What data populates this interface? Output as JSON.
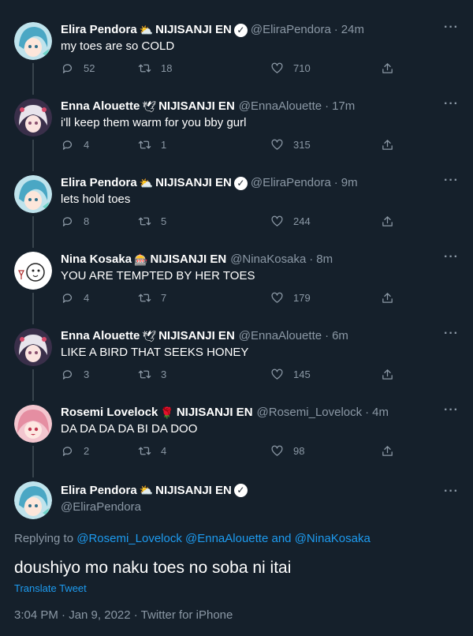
{
  "tweets": [
    {
      "name": "Elira Pendora",
      "emoji": "⛅",
      "org": "NIJISANJI EN",
      "verified": true,
      "handle": "@EliraPendora",
      "time": "24m",
      "text": "my toes are so COLD",
      "replies": "52",
      "retweets": "18",
      "likes": "710",
      "avatar": "elira-avatar"
    },
    {
      "name": "Enna Alouette",
      "emoji": "🕊",
      "org": "NIJISANJI EN",
      "verified": false,
      "handle": "@EnnaAlouette",
      "time": "17m",
      "text": "i'll keep them warm for you bby gurl",
      "replies": "4",
      "retweets": "1",
      "likes": "315",
      "avatar": "enna-avatar"
    },
    {
      "name": "Elira Pendora",
      "emoji": "⛅",
      "org": "NIJISANJI EN",
      "verified": true,
      "handle": "@EliraPendora",
      "time": "9m",
      "text": "lets hold toes",
      "replies": "8",
      "retweets": "5",
      "likes": "244",
      "avatar": "elira-avatar"
    },
    {
      "name": "Nina Kosaka",
      "emoji": "🎰",
      "org": "NIJISANJI EN",
      "verified": false,
      "handle": "@NinaKosaka",
      "time": "8m",
      "text": "YOU ARE TEMPTED BY HER TOES",
      "replies": "4",
      "retweets": "7",
      "likes": "179",
      "avatar": "nina-avatar"
    },
    {
      "name": "Enna Alouette",
      "emoji": "🕊",
      "org": "NIJISANJI EN",
      "verified": false,
      "handle": "@EnnaAlouette",
      "time": "6m",
      "text": "LIKE A BIRD THAT SEEKS HONEY",
      "replies": "3",
      "retweets": "3",
      "likes": "145",
      "avatar": "enna-avatar"
    },
    {
      "name": "Rosemi Lovelock",
      "emoji": "🌹",
      "org": "NIJISANJI EN",
      "verified": false,
      "handle": "@Rosemi_Lovelock",
      "time": "4m",
      "text": "DA DA DA DA BI DA DOO",
      "replies": "2",
      "retweets": "4",
      "likes": "98",
      "avatar": "rosemi-avatar"
    }
  ],
  "main_tweet": {
    "name": "Elira Pendora",
    "emoji": "⛅",
    "org": "NIJISANJI EN",
    "handle": "@EliraPendora",
    "replying_prefix": "Replying to",
    "replying_to_1": "@Rosemi_Lovelock",
    "replying_to_2": "@EnnaAlouette",
    "replying_and": "and",
    "replying_to_3": "@NinaKosaka",
    "text": "doushiyo mo naku toes no soba ni itai",
    "translate": "Translate Tweet",
    "meta": "3:04 PM · Jan 9, 2022 · Twitter for iPhone"
  },
  "dot": "·",
  "more_label": "···",
  "colors": {
    "background": "#15202b",
    "accent": "#1d9bf0",
    "muted": "#8b98a5",
    "thread": "#38444d"
  }
}
